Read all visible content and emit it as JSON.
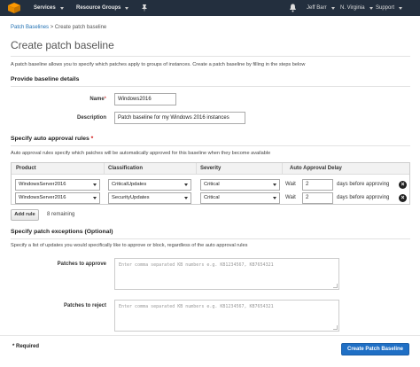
{
  "topbar": {
    "services_label": "Services",
    "resource_groups_label": "Resource Groups",
    "user_label": "Jeff Barr",
    "region_label": "N. Virginia",
    "support_label": "Support"
  },
  "breadcrumb": {
    "parent": "Patch Baselines",
    "separator": ">",
    "current": "Create patch baseline"
  },
  "page": {
    "title": "Create patch baseline",
    "intro": "A patch baseline allows you to specify which patches apply to groups of instances. Create a patch baseline by filling in the steps below"
  },
  "baseline_details": {
    "section_title": "Provide baseline details",
    "name_label": "Name",
    "name_required_mark": "*",
    "name_value": "Windows2016",
    "description_label": "Description",
    "description_value": "Patch baseline for my Windows 2016 instances"
  },
  "approval_rules": {
    "section_title": "Specify auto approval rules",
    "required_mark": "*",
    "helper": "Auto approval rules specify which patches will be automatically approved for this baseline when they become available",
    "columns": [
      "Product",
      "Classification",
      "Severity",
      "Auto Approval Delay"
    ],
    "rows": [
      {
        "product": "WindowsServer2016",
        "classification": "CriticalUpdates",
        "severity": "Critical",
        "wait_label": "Wait",
        "wait_value": "2",
        "days_label": "days before approving"
      },
      {
        "product": "WindowsServer2016",
        "classification": "SecurityUpdates",
        "severity": "Critical",
        "wait_label": "Wait",
        "wait_value": "2",
        "days_label": "days before approving"
      }
    ],
    "add_rule_label": "Add rule",
    "remaining_label": "8 remaining"
  },
  "exceptions": {
    "section_title": "Specify patch exceptions (Optional)",
    "helper": "Specify a list of updates you would specifically like to approve or block, regardless of the auto approval rules",
    "approve_label": "Patches to approve",
    "approve_placeholder": "Enter comma separated KB numbers e.g. KB1234567, KB7654321",
    "reject_label": "Patches to reject",
    "reject_placeholder": "Enter comma separated KB numbers e.g. KB1234567, KB7654321"
  },
  "footer": {
    "required_note": "* Required",
    "create_button_label": "Create Patch Baseline"
  },
  "colors": {
    "topbar": "#232f3e",
    "link": "#1f6fb2",
    "primary": "#1f6fc5",
    "aws_orange": "#ff9900"
  },
  "icons": [
    "aws-cube-icon",
    "pin-icon",
    "bell-icon",
    "caret-down-icon",
    "remove-circle-icon"
  ]
}
